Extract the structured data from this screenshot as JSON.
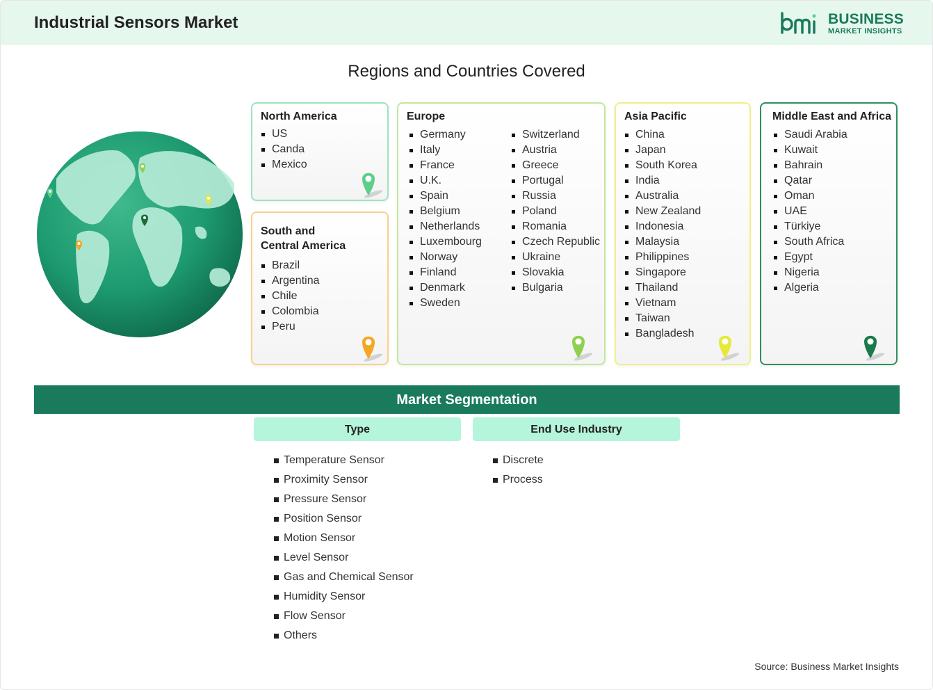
{
  "header": {
    "title": "Industrial Sensors Market"
  },
  "logo": {
    "line1": "BUSINESS",
    "line2": "MARKET INSIGHTS",
    "mark": "bmi"
  },
  "subtitle": "Regions and Countries Covered",
  "regions": {
    "north_america": {
      "title": "North America",
      "items": [
        "US",
        "Canda",
        "Mexico"
      ],
      "color": "#5ccf8a"
    },
    "south_america": {
      "title_line1": "South and",
      "title_line2": "Central America",
      "items": [
        "Brazil",
        "Argentina",
        "Chile",
        "Colombia",
        "Peru"
      ],
      "color": "#f5a623"
    },
    "europe": {
      "title": "Europe",
      "items_col1": [
        "Germany",
        "Italy",
        "France",
        "U.K.",
        "Spain",
        "Belgium",
        "Netherlands",
        "Luxembourg",
        "Norway",
        "Finland",
        "Denmark",
        "Sweden"
      ],
      "items_col2": [
        "Switzerland",
        "Austria",
        "Greece",
        "Portugal",
        "Russia",
        "Poland",
        "Romania",
        "Czech Republic",
        "Ukraine",
        "Slovakia",
        "Bulgaria"
      ],
      "color": "#8fd14f"
    },
    "asia_pacific": {
      "title": "Asia Pacific",
      "items": [
        "China",
        "Japan",
        "South Korea",
        "India",
        "Australia",
        "New Zealand",
        "Indonesia",
        "Malaysia",
        "Philippines",
        "Singapore",
        "Thailand",
        "Vietnam",
        "Taiwan",
        "Bangladesh"
      ],
      "color": "#e8e83a"
    },
    "mea": {
      "title": "Middle East and Africa",
      "items": [
        "Saudi Arabia",
        "Kuwait",
        "Bahrain",
        "Qatar",
        "Oman",
        "UAE",
        "Türkiye",
        "South Africa",
        "Egypt",
        "Nigeria",
        "Algeria"
      ],
      "color": "#1a7a4a"
    }
  },
  "segmentation": {
    "title": "Market Segmentation",
    "type": {
      "header": "Type",
      "items": [
        "Temperature Sensor",
        "Proximity Sensor",
        "Pressure Sensor",
        "Position Sensor",
        "Motion Sensor",
        "Level Sensor",
        "Gas and Chemical Sensor",
        "Humidity Sensor",
        "Flow Sensor",
        "Others"
      ]
    },
    "end_use": {
      "header": "End Use Industry",
      "items": [
        "Discrete",
        "Process"
      ]
    }
  },
  "source": "Source: Business Market Insights"
}
